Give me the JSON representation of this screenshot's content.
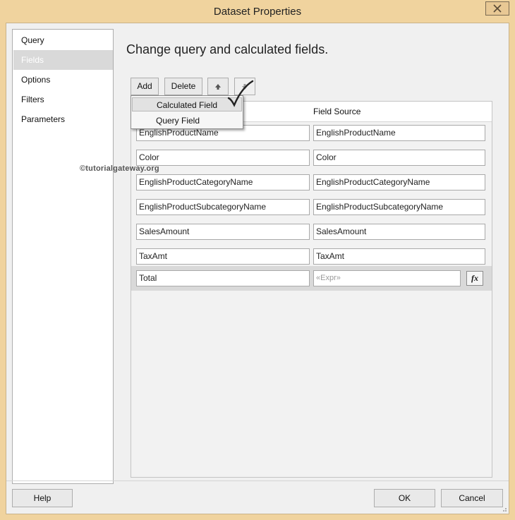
{
  "window": {
    "title": "Dataset Properties"
  },
  "nav": {
    "items": [
      {
        "label": "Query"
      },
      {
        "label": "Fields"
      },
      {
        "label": "Options"
      },
      {
        "label": "Filters"
      },
      {
        "label": "Parameters"
      }
    ],
    "selected": "Fields"
  },
  "main": {
    "heading": "Change query and calculated fields.",
    "toolbar": {
      "add_label": "Add",
      "delete_label": "Delete",
      "move_up_icon": "arrow-up-icon",
      "move_down_icon": "arrow-down-icon"
    },
    "add_menu": {
      "items": [
        {
          "label": "Calculated Field"
        },
        {
          "label": "Query Field"
        }
      ],
      "highlighted": "Calculated Field"
    },
    "grid": {
      "columns": {
        "field_source": "Field Source"
      },
      "rows": [
        {
          "name": "EnglishProductName",
          "source": "EnglishProductName"
        },
        {
          "name": "Color",
          "source": "Color"
        },
        {
          "name": "EnglishProductCategoryName",
          "source": "EnglishProductCategoryName"
        },
        {
          "name": "EnglishProductSubcategoryName",
          "source": "EnglishProductSubcategoryName"
        },
        {
          "name": "SalesAmount",
          "source": "SalesAmount"
        },
        {
          "name": "TaxAmt",
          "source": "TaxAmt"
        }
      ],
      "calculated_row": {
        "name": "Total",
        "source_placeholder": "«Expr»",
        "expression_button": "fx"
      }
    }
  },
  "watermark": "©tutorialgateway.org",
  "footer": {
    "help_label": "Help",
    "ok_label": "OK",
    "cancel_label": "Cancel"
  },
  "colors": {
    "title_bar": "#f0d39e",
    "selected_row": "#d9d9d9"
  }
}
